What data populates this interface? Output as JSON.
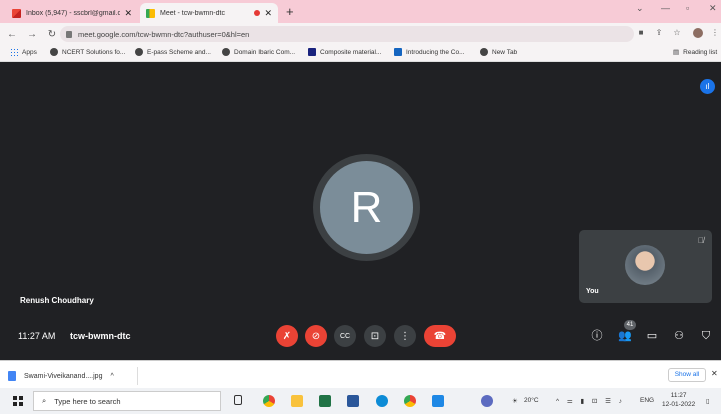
{
  "browser": {
    "tabs": [
      {
        "title": "Inbox (5,947) - sscbrl@gmail.co",
        "active": false
      },
      {
        "title": "Meet - tcw-bwmn-dtc",
        "active": true
      }
    ],
    "url": "meet.google.com/tcw-bwmn-dtc?authuser=0&hl=en",
    "bookmarks": [
      "Apps",
      "NCERT Solutions fo...",
      "E-pass Scheme and...",
      "Domain Ibaric Com...",
      "Composite material...",
      "Introducing the Co...",
      "New Tab"
    ],
    "reading_list": "Reading list"
  },
  "meet": {
    "avatar_initial": "R",
    "speaker_name": "Renush Choudhary",
    "self_label": "You",
    "time": "11:27 AM",
    "meeting_code": "tcw-bwmn-dtc",
    "participants_count": "41"
  },
  "downloads": {
    "file": "Swami-Viveikanand....jpg",
    "show_all": "Show all"
  },
  "taskbar": {
    "search_placeholder": "Type here to search",
    "weather": "20°C",
    "language": "ENG",
    "clock_time": "11:27",
    "clock_date": "12-01-2022"
  },
  "colors": {
    "meet_bg": "#202124",
    "red": "#ea4335",
    "tab_bar": "#f7cbd6",
    "avatar": "#7b8d99"
  }
}
